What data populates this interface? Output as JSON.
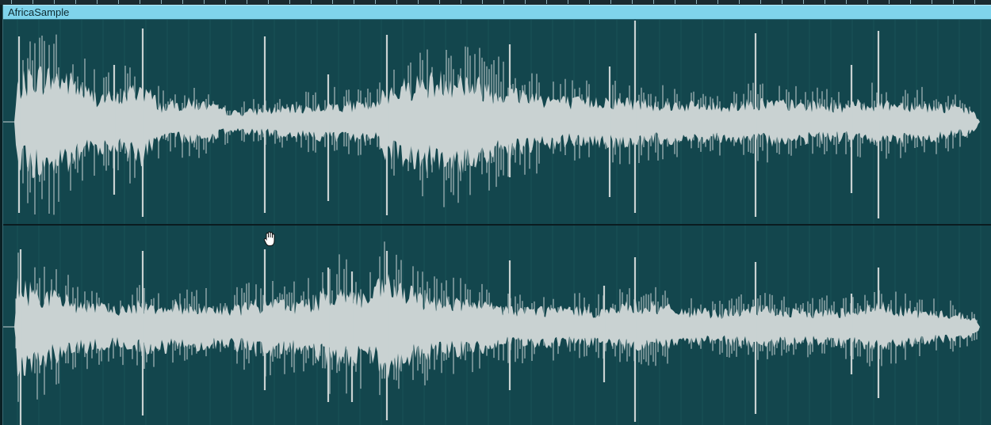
{
  "event": {
    "name": "AfricaSample"
  },
  "icons": {
    "cursor": "hand-grab-icon"
  },
  "colors": {
    "background": "#13464d",
    "header": "#7fd4ec",
    "waveform": "#c9d2d2",
    "grid": "#1c5860",
    "divider": "#0a1c20"
  },
  "channels": [
    {
      "id": "left"
    },
    {
      "id": "right"
    }
  ]
}
